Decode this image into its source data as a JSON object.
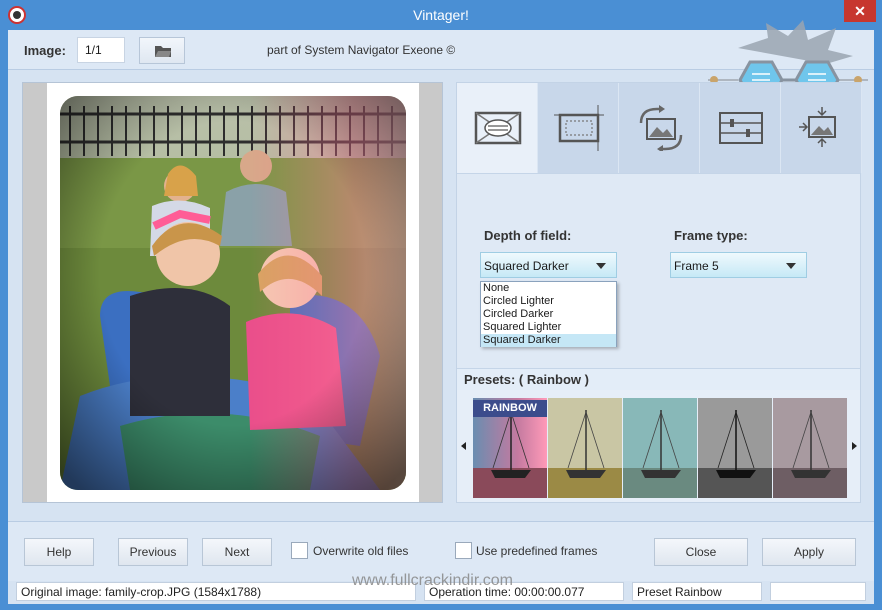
{
  "window": {
    "title": "Vintager!",
    "close_glyph": "✕"
  },
  "toolbar": {
    "image_label": "Image:",
    "image_value": "1/1",
    "open_icon": "folder-open-icon",
    "tagline": "part of System Navigator Exeone ©"
  },
  "tabs": [
    {
      "icon": "vignette-icon",
      "active": true
    },
    {
      "icon": "crop-frame-icon",
      "active": false
    },
    {
      "icon": "rotate-image-icon",
      "active": false
    },
    {
      "icon": "adjust-sliders-icon",
      "active": false
    },
    {
      "icon": "resize-image-icon",
      "active": false
    }
  ],
  "options": {
    "depth_label": "Depth of field:",
    "depth_selected": "Squared Darker",
    "depth_options": [
      "None",
      "Circled Lighter",
      "Circled Darker",
      "Squared Lighter",
      "Squared Darker"
    ],
    "frame_label": "Frame type:",
    "frame_selected": "Frame 5"
  },
  "presets": {
    "label": "Presets: ( Rainbow )",
    "items": [
      {
        "name": "RAINBOW",
        "label_visible": true
      },
      {
        "name": "sepia-yellow",
        "label_visible": false
      },
      {
        "name": "teal",
        "label_visible": false
      },
      {
        "name": "grayscale",
        "label_visible": false
      },
      {
        "name": "muted",
        "label_visible": false
      }
    ]
  },
  "buttons": {
    "help": "Help",
    "previous": "Previous",
    "next": "Next",
    "overwrite": "Overwrite old files",
    "predefined": "Use predefined frames",
    "close": "Close",
    "apply": "Apply"
  },
  "status": {
    "original": "Original image: family-crop.JPG (1584x1788)",
    "optime": "Operation time: 00:00:00.077",
    "preset": "Preset Rainbow",
    "empty": ""
  },
  "watermark": "www.fullcrackindir.com",
  "colors": {
    "titlebar": "#4a8fd4",
    "panel": "#dde8f5",
    "accent_select": "#c6e9f6",
    "close_red": "#c7372f"
  }
}
